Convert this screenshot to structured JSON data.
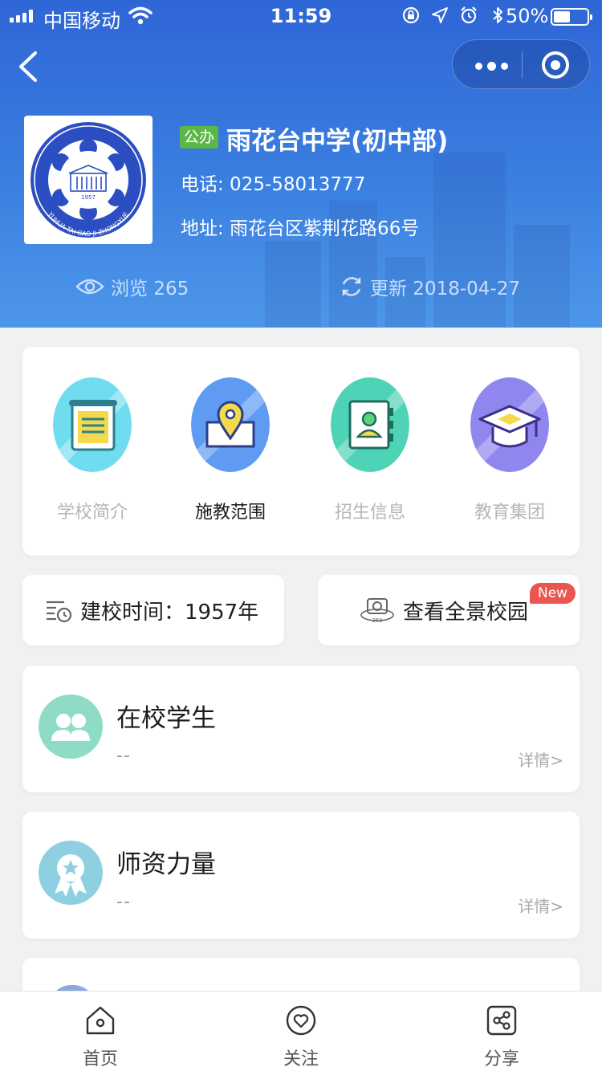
{
  "status_bar": {
    "carrier": "中国移动",
    "time": "11:59",
    "battery": "50%",
    "battery_level": 0.5
  },
  "nav": {
    "back_icon": "chevron-left-icon",
    "more_icon": "more-dots-icon",
    "close_icon": "target-circle-icon"
  },
  "school": {
    "badge": "公办",
    "name": "雨花台中学(初中部)",
    "phone": "电话: 025-58013777",
    "address": "地址: 雨花台区紫荆花路66号",
    "logo_text": "YUHUA TAI GAO JI ZHONGXUE",
    "logo_year": "1957"
  },
  "stats_row": {
    "views": "浏览 265",
    "updated": "更新 2018-04-27"
  },
  "categories": [
    {
      "label": "学校简介",
      "icon": "scroll-icon",
      "active": false
    },
    {
      "label": "施教范围",
      "icon": "map-pin-icon",
      "active": true
    },
    {
      "label": "招生信息",
      "icon": "contact-book-icon",
      "active": false
    },
    {
      "label": "教育集团",
      "icon": "graduation-cap-icon",
      "active": false
    }
  ],
  "info": {
    "founded": "建校时间：1957年",
    "panorama": "查看全景校园",
    "new_badge": "New",
    "camera_caption": "360"
  },
  "cards": [
    {
      "title": "在校学生",
      "value": "--",
      "detail": "详情>",
      "icon": "students-icon"
    },
    {
      "title": "师资力量",
      "value": "--",
      "detail": "详情>",
      "icon": "award-ribbon-icon"
    }
  ],
  "tabs": [
    {
      "label": "首页",
      "icon": "home-icon"
    },
    {
      "label": "关注",
      "icon": "heart-icon"
    },
    {
      "label": "分享",
      "icon": "share-icon"
    }
  ],
  "colors": {
    "header_top": "#2f66d6",
    "header_bottom": "#4d97ea",
    "badge_green": "#5bb847",
    "new_red": "#e9564f"
  }
}
